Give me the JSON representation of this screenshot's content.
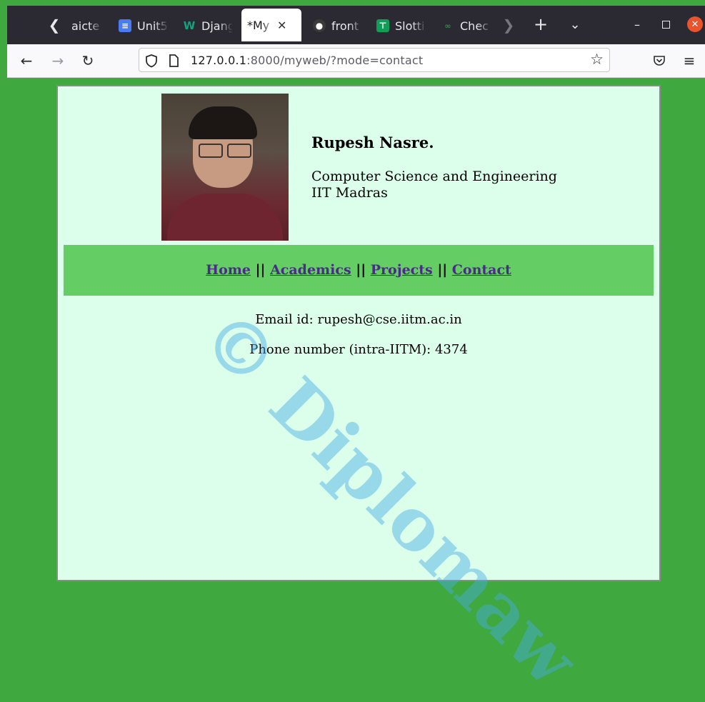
{
  "tabs": [
    {
      "label": "aicte",
      "icon": "none"
    },
    {
      "label": "Unit5",
      "icon": "docs-icon",
      "color": "#4a7bf0"
    },
    {
      "label": "Djang",
      "icon": "w-icon",
      "color": "#14a37f"
    },
    {
      "label": "*My W",
      "icon": "none",
      "active": true
    },
    {
      "label": "front",
      "icon": "github-icon"
    },
    {
      "label": "Slotti",
      "icon": "sheets-icon",
      "color": "#0f9d58"
    },
    {
      "label": "Chec",
      "icon": "gfg-icon",
      "color": "#2f8d46"
    }
  ],
  "url": {
    "host": "127.0.0.1",
    "rest": ":8000/myweb/?mode=contact"
  },
  "profile": {
    "name": "Rupesh Nasre.",
    "dept_line1": "Computer Science and Engineering",
    "dept_line2": "IIT Madras"
  },
  "menu": {
    "home": "Home",
    "academics": "Academics",
    "projects": "Projects",
    "contact": "Contact",
    "sep": "||"
  },
  "contact": {
    "email": "Email id: rupesh@cse.iitm.ac.in",
    "phone": "Phone number (intra-IITM): 4374"
  },
  "watermark": "© Diplomaw",
  "colors": {
    "page_bg": "#3fa83f",
    "content_bg": "#dbffeb",
    "menu_bg": "#64cd64",
    "link": "#4b2a8a"
  }
}
